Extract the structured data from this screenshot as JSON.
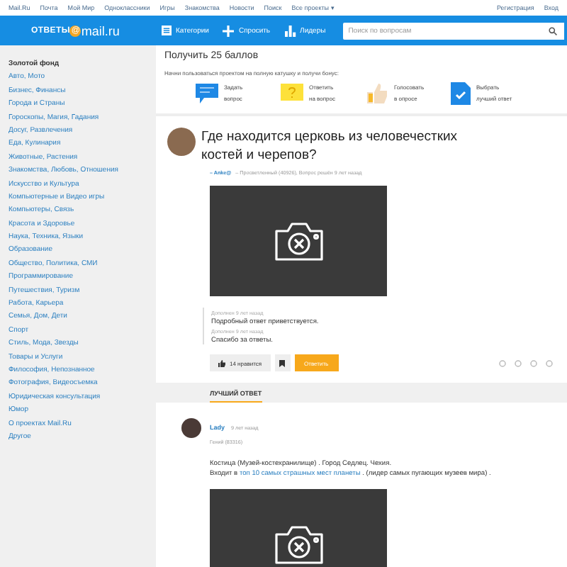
{
  "top_links": [
    "Mail.Ru",
    "Почта",
    "Мой Мир",
    "Одноклассники",
    "Игры",
    "Знакомства",
    "Новости",
    "Поиск",
    "Все проекты ▾"
  ],
  "top_right": [
    "Регистрация",
    "Вход"
  ],
  "logo": {
    "left": "ОТВЕТЫ",
    "at": "@",
    "right": "mail.ru"
  },
  "nav": [
    {
      "kind": "categories",
      "label": "Категории"
    },
    {
      "kind": "ask",
      "label": "Спросить"
    },
    {
      "kind": "leaders",
      "label": "Лидеры"
    }
  ],
  "search": {
    "placeholder": "Поиск по вопросам"
  },
  "sidebar": {
    "heading": "Золотой фонд",
    "items": [
      "Авто, Мото",
      "Бизнес, Финансы",
      "Города и Страны",
      "Гороскопы, Магия, Гадания",
      "Досуг, Развлечения",
      "Еда, Кулинария",
      "Животные, Растения",
      "Знакомства, Любовь, Отношения",
      "Искусство и Культура",
      "Компьютерные и Видео игры",
      "Компьютеры, Связь",
      "Красота и Здоровье",
      "Наука, Техника, Языки",
      "Образование",
      "Общество, Политика, СМИ",
      "Программирование",
      "Путешествия, Туризм",
      "Работа, Карьера",
      "Семья, Дом, Дети",
      "Спорт",
      "Стиль, Мода, Звезды",
      "Товары и Услуги",
      "Философия, Непознанное",
      "Фотография, Видеосъемка",
      "Юридическая консультация",
      "Юмор",
      "О проектах Mail.Ru",
      "Другое"
    ]
  },
  "bonus": {
    "title": "Получить 25 баллов",
    "subtitle": "Начни пользоваться проектом на полную катушку и получи бонус:",
    "items": [
      {
        "kind": "ask",
        "line1": "Задать",
        "line2": "вопрос"
      },
      {
        "kind": "answer",
        "line1": "Ответить",
        "line2": "на вопрос"
      },
      {
        "kind": "vote",
        "line1": "Голосовать",
        "line2": "в опросе"
      },
      {
        "kind": "best",
        "line1": "Выбрать",
        "line2": "лучший ответ"
      }
    ]
  },
  "question": {
    "title": "Где находится церковь из человечестких костей и черепов?",
    "author": "– Anke@",
    "meta": "– Просветленный (40926), Вопрос решён 9 лет назад",
    "additions": [
      {
        "when": "Дополнен 9 лет назад",
        "text": "Подробный ответ приветствуется."
      },
      {
        "when": "Дополнен 9 лет назад",
        "text": "Спасибо за ответы."
      }
    ],
    "likes": "14 нравится",
    "reply": "Ответить"
  },
  "best_answer": {
    "tab": "ЛУЧШИЙ ОТВЕТ",
    "author": "Lady",
    "when": "9 лет назад",
    "rank": "Гений (83316)",
    "line1": "Костица (Музей-костехранилище) . Город Седлец. Чехия.",
    "line2_pre": "Входит в",
    "link": "топ 10 самых страшных мест планеты",
    "line2_post": ". (лидер самых пугающих музеев мира) ."
  }
}
